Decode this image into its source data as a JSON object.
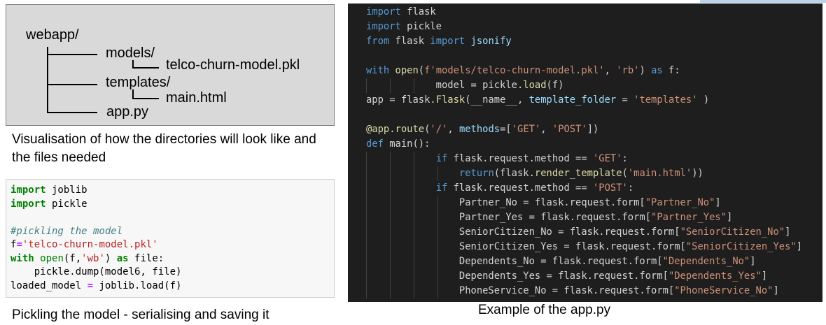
{
  "tree": {
    "root": "webapp/",
    "models": "models/",
    "model_file": "telco-churn-model.pkl",
    "templates": "templates/",
    "template_file": "main.html",
    "app_file": "app.py"
  },
  "tree_caption": "Visualisation of how the directories will look like and the files needed",
  "notebook": {
    "lines": [
      "import joblib",
      "import pickle",
      "",
      "#pickling the model",
      "f='telco-churn-model.pkl'",
      "with open(f,'wb') as file:",
      "    pickle.dump(model6, file)",
      "loaded_model = joblib.load(f)"
    ]
  },
  "notebook_caption": "Pickling the model - serialising and saving it",
  "editor": {
    "lines": [
      "import flask",
      "import pickle",
      "from flask import jsonify",
      "",
      "with open(f'models/telco-churn-model.pkl', 'rb') as f:",
      "            model = pickle.load(f)",
      "app = flask.Flask(__name__, template_folder = 'templates' )",
      "",
      "@app.route('/', methods=['GET', 'POST'])",
      "def main():",
      "            if flask.request.method == 'GET':",
      "                return(flask.render_template('main.html'))",
      "            if flask.request.method == 'POST':",
      "                Partner_No = flask.request.form[\"Partner_No\"]",
      "                Partner_Yes = flask.request.form[\"Partner_Yes\"]",
      "                SeniorCitizen_No = flask.request.form[\"SeniorCitizen_No\"]",
      "                SeniorCitizen_Yes = flask.request.form[\"SeniorCitizen_Yes\"]",
      "                Dependents_No = flask.request.form[\"Dependents_No\"]",
      "                Dependents_Yes = flask.request.form[\"Dependents_Yes\"]",
      "                PhoneService_No = flask.request.form[\"PhoneService_No\"]"
    ]
  },
  "editor_caption": "Example of the app.py",
  "colors": {
    "tree_bg": "#d9d9d9",
    "editor_bg": "#1e1e1e",
    "keyword": "#569cd6",
    "string": "#ce9178",
    "notebook_keyword": "#008000"
  }
}
